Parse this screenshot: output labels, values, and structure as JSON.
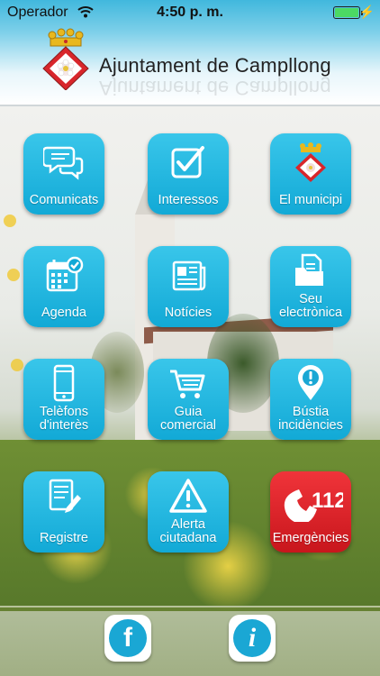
{
  "status_bar": {
    "carrier": "Operador",
    "time": "4:50 p. m.",
    "battery": 1.0
  },
  "header": {
    "title": "Ajuntament de Campllong"
  },
  "tiles": [
    {
      "label": "Comunicats",
      "icon": "speech-bubbles-icon",
      "color": "#1eb1db"
    },
    {
      "label": "Interessos",
      "icon": "checkbox-icon",
      "color": "#1eb1db"
    },
    {
      "label": "El municipi",
      "icon": "coat-of-arms-icon",
      "color": "#1eb1db"
    },
    {
      "label": "Agenda",
      "icon": "calendar-icon",
      "color": "#1eb1db"
    },
    {
      "label": "Notícies",
      "icon": "newspaper-icon",
      "color": "#1eb1db"
    },
    {
      "label_line1": "Seu",
      "label_line2": "electrònica",
      "icon": "folder-document-icon",
      "color": "#1eb1db"
    },
    {
      "label_line1": "Telèfons",
      "label_line2": "d'interès",
      "icon": "smartphone-icon",
      "color": "#1eb1db"
    },
    {
      "label_line1": "Guia",
      "label_line2": "comercial",
      "icon": "shopping-cart-icon",
      "color": "#1eb1db"
    },
    {
      "label_line1": "Bústia",
      "label_line2": "incidències",
      "icon": "map-pin-alert-icon",
      "color": "#1eb1db"
    },
    {
      "label": "Registre",
      "icon": "form-pencil-icon",
      "color": "#1eb1db"
    },
    {
      "label_line1": "Alerta",
      "label_line2": "ciutadana",
      "icon": "warning-triangle-icon",
      "color": "#1eb1db"
    },
    {
      "label": "Emergències",
      "icon": "phone-112-icon",
      "icon_text": "112",
      "color": "#d91f25"
    }
  ],
  "footer": {
    "facebook_glyph": "f",
    "info_glyph": "i"
  }
}
